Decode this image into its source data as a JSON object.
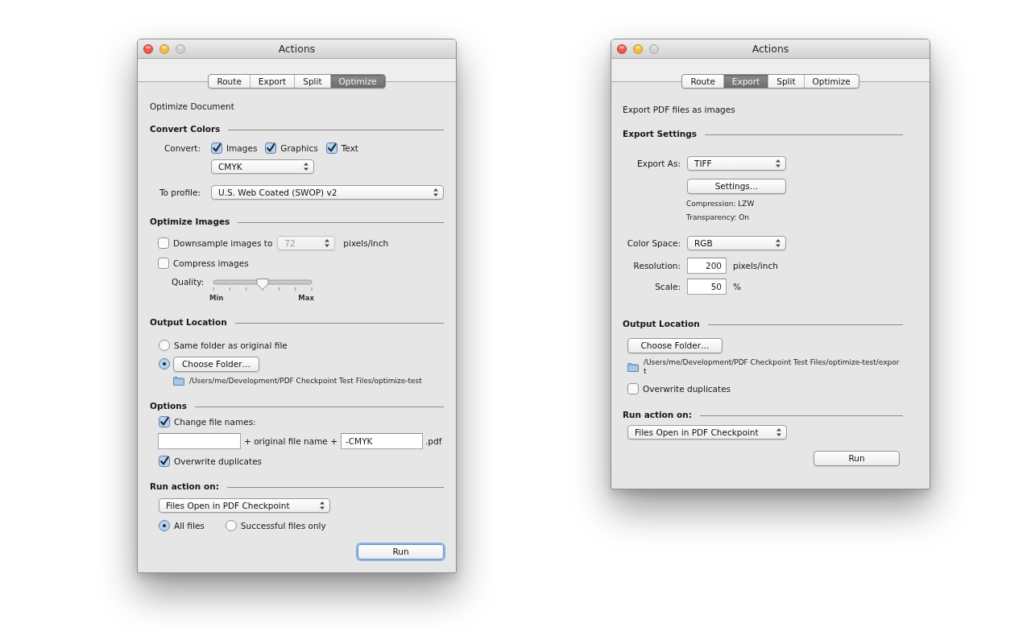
{
  "windows": [
    {
      "kind": "optimize",
      "title": "Actions",
      "window_buttons": [
        {
          "kind": "close",
          "disabled": false
        },
        {
          "kind": "minimize",
          "disabled": false
        },
        {
          "kind": "zoom",
          "disabled": true
        }
      ],
      "tabs": [
        {
          "label": "Route",
          "selected": false
        },
        {
          "label": "Export",
          "selected": false
        },
        {
          "label": "Split",
          "selected": false
        },
        {
          "label": "Optimize",
          "selected": true
        }
      ],
      "description": "Optimize Document",
      "convert_colors": {
        "heading": "Convert Colors",
        "convert_label": "Convert:",
        "checkboxes": [
          {
            "label": "Images",
            "checked": true
          },
          {
            "label": "Graphics",
            "checked": true
          },
          {
            "label": "Text",
            "checked": true
          }
        ],
        "color_model_popup": "CMYK",
        "profile_label": "To profile:",
        "profile_popup": "U.S. Web Coated (SWOP) v2"
      },
      "optimize_images": {
        "heading": "Optimize Images",
        "downsample": {
          "label": "Downsample images to",
          "checked": false,
          "resolution_popup": {
            "value": "72",
            "disabled": true
          },
          "unit": "pixels/inch"
        },
        "compress": {
          "label": "Compress images",
          "checked": false
        },
        "quality": {
          "label": "Quality:",
          "level": 0.5,
          "min_label": "Min",
          "max_label": "Max"
        }
      },
      "output_location": {
        "heading": "Output Location",
        "options": [
          {
            "kind": "label",
            "label": "Same folder as original file",
            "selected": false
          },
          {
            "kind": "button",
            "label": "Choose Folder…",
            "selected": true
          }
        ],
        "path": "/Users/me/Development/PDF Checkpoint Test Files/optimize-test"
      },
      "options": {
        "heading": "Options",
        "change_file_names": {
          "label": "Change file names:",
          "checked": true
        },
        "name_joiner": "+ original file name +",
        "suffix_field": "-CMYK",
        "extension": ".pdf",
        "overwrite": {
          "label": "Overwrite duplicates",
          "checked": true
        }
      },
      "run_action": {
        "heading": "Run action on:",
        "popup": "Files Open in PDF Checkpoint",
        "scope": [
          {
            "label": "All files",
            "selected": true
          },
          {
            "label": "Successful files only",
            "selected": false
          }
        ],
        "run_button": {
          "label": "Run",
          "focused": true
        }
      }
    },
    {
      "kind": "export",
      "title": "Actions",
      "window_buttons": [
        {
          "kind": "close",
          "disabled": false
        },
        {
          "kind": "minimize",
          "disabled": false
        },
        {
          "kind": "zoom",
          "disabled": true
        }
      ],
      "tabs": [
        {
          "label": "Route",
          "selected": false
        },
        {
          "label": "Export",
          "selected": true
        },
        {
          "label": "Split",
          "selected": false
        },
        {
          "label": "Optimize",
          "selected": false
        }
      ],
      "description": "Export PDF files as images",
      "export_settings": {
        "heading": "Export Settings",
        "export_as_label": "Export As:",
        "export_as_popup": "TIFF",
        "settings_button": "Settings…",
        "compression": "Compression: LZW",
        "transparency": "Transparency: On",
        "color_space_label": "Color Space:",
        "color_space_popup": "RGB",
        "resolution_label": "Resolution:",
        "resolution_field": "200",
        "resolution_unit": "pixels/inch",
        "scale_label": "Scale:",
        "scale_field": "50",
        "scale_unit": "%"
      },
      "output_location": {
        "heading": "Output Location",
        "choose_button": "Choose Folder…",
        "path": "/Users/me/Development/PDF Checkpoint Test Files/optimize-test/export",
        "overwrite": {
          "label": "Overwrite duplicates",
          "checked": false
        }
      },
      "run_action": {
        "heading": "Run action on:",
        "popup": "Files Open in PDF Checkpoint",
        "run_button": {
          "label": "Run",
          "focused": false
        }
      }
    }
  ]
}
